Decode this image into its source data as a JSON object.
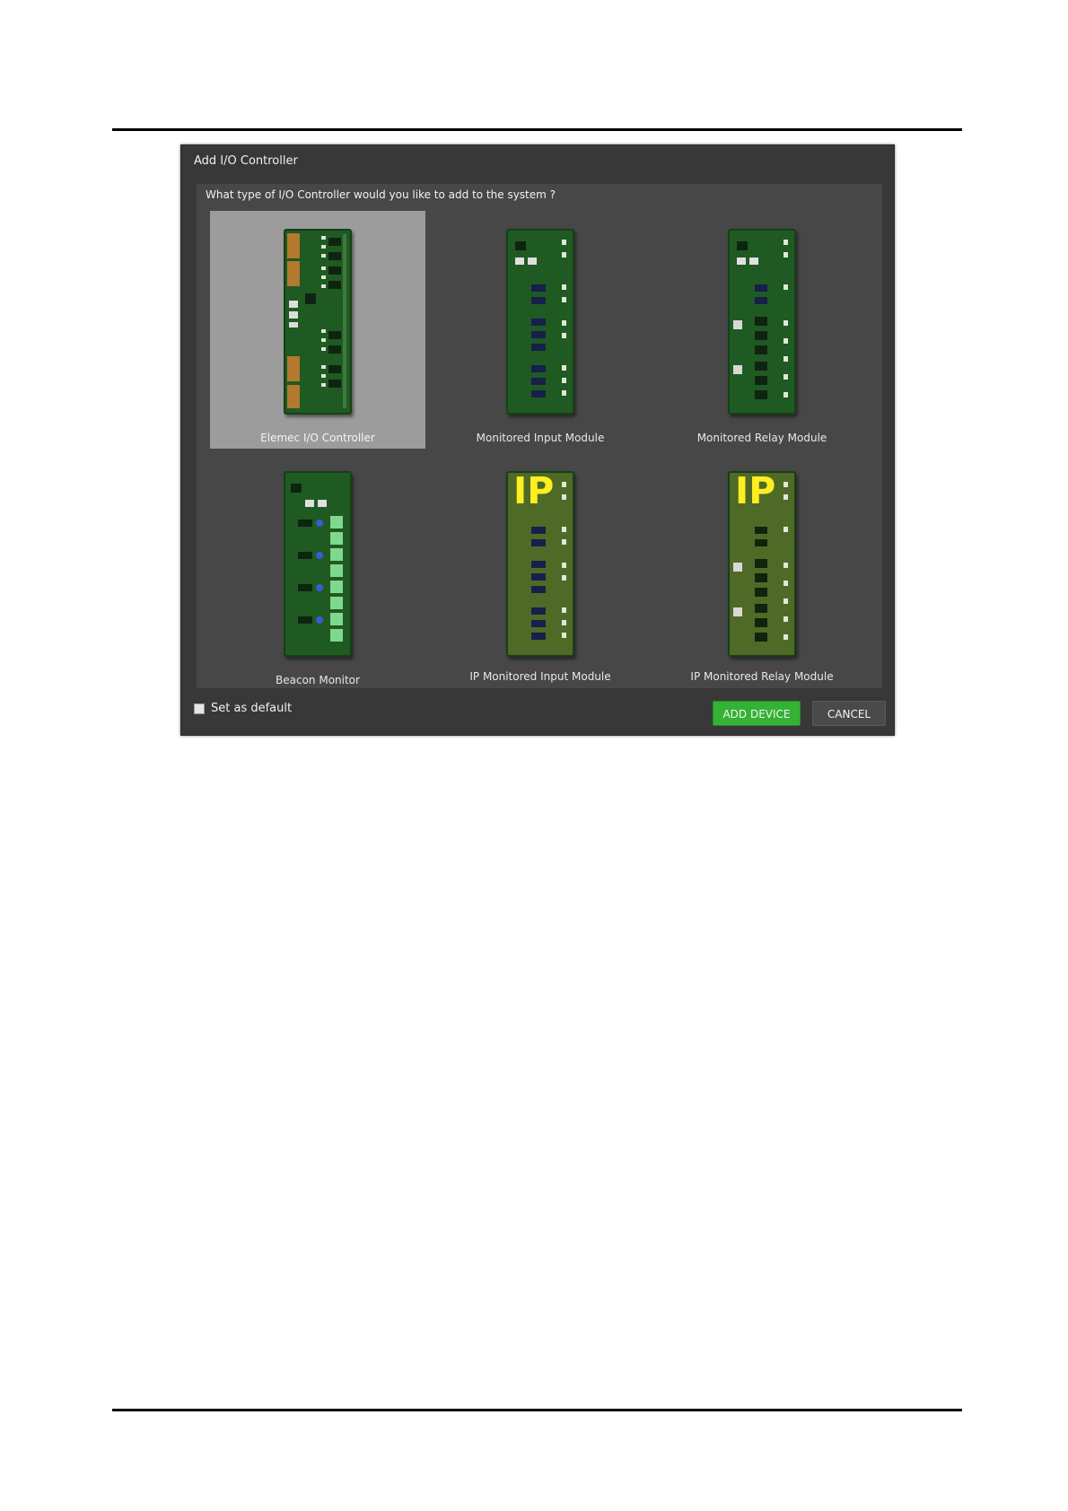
{
  "dialog": {
    "title": "Add I/O Controller",
    "prompt": "What type of I/O Controller would you like to add to the system ?",
    "options": [
      {
        "label": "Elemec I/O Controller",
        "selected": true,
        "ip": false,
        "icon": "elemec-io-board-icon"
      },
      {
        "label": "Monitored Input Module",
        "selected": false,
        "ip": false,
        "icon": "input-module-board-icon"
      },
      {
        "label": "Monitored Relay Module",
        "selected": false,
        "ip": false,
        "icon": "relay-module-board-icon"
      },
      {
        "label": "Beacon Monitor",
        "selected": false,
        "ip": false,
        "icon": "beacon-monitor-board-icon"
      },
      {
        "label": "IP Monitored Input Module",
        "selected": false,
        "ip": true,
        "ip_badge": "IP",
        "icon": "ip-input-module-board-icon"
      },
      {
        "label": "IP Monitored Relay Module",
        "selected": false,
        "ip": true,
        "ip_badge": "IP",
        "icon": "ip-relay-module-board-icon"
      }
    ],
    "set_default_label": "Set as default",
    "set_default_checked": false,
    "add_button": "ADD DEVICE",
    "cancel_button": "CANCEL"
  },
  "colors": {
    "dialog_bg": "#383838",
    "body_bg": "#474747",
    "selected_tile": "#9c9c9c",
    "add_button": "#33b233",
    "pcb_green": "#1f5a22",
    "ip_badge": "#ffee22"
  }
}
